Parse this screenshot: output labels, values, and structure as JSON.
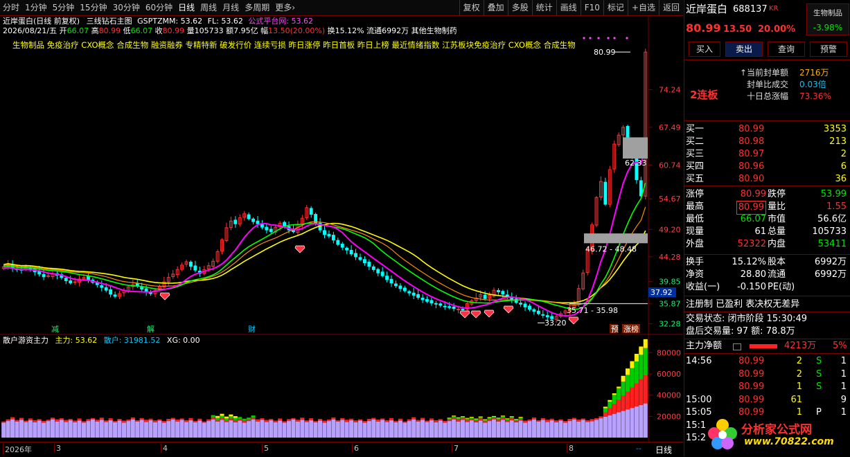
{
  "toolbar": {
    "left": [
      "分时",
      "1分钟",
      "5分钟",
      "15分钟",
      "30分钟",
      "60分钟",
      "日线",
      "周线",
      "月线",
      "多周期",
      "更多›"
    ],
    "right": [
      "复权",
      "叠加",
      "多股",
      "统计",
      "画线",
      "F10",
      "标记",
      "+自选",
      "返回"
    ],
    "active": "日线"
  },
  "header": {
    "stock_title": "近岸蛋白(日线 前复权)",
    "indicator_main": "三线钻石主图",
    "gsp": "GSPTZMM: 53.62",
    "fl": "FL: 53.62",
    "formula_site": "公式平台网: 53.62",
    "date": "2026/08/21/五",
    "open_label": "开",
    "open": "66.07",
    "high_label": "高",
    "high": "80.99",
    "low_label": "低",
    "low": "66.07",
    "close_label": "收",
    "close": "80.99",
    "vol_label": "量",
    "vol": "105733",
    "amt_label": "额",
    "amt": "7.95亿",
    "chg_label": "幅",
    "chg": "13.50(20.00%)",
    "turnover": "换15.12%",
    "float": "流通6992万",
    "industry": "其他生物制药",
    "concepts": "生物制品 免疫治疗 CXO概念 合成生物 融资融券 专精特新 破发行价 连续亏损 昨日涨停 昨日首板 昨日上榜 最近情绪指数 江苏板块免疫治疗 CXO概念 合成生物"
  },
  "price_axis": [
    "74.24",
    "67.49",
    "60.74",
    "54.67",
    "49.20",
    "44.28",
    "39.85",
    "35.87",
    "32.28"
  ],
  "current_price_tag": "37.92",
  "annotations": {
    "high_label": "80.99",
    "gap_upper": "62.33",
    "gap_mid": "46.72 - 48.48",
    "gap_low": "35.71 - 35.98",
    "low_label": "33.20"
  },
  "event_markers": [
    {
      "text": "减",
      "color": "#00ff66"
    },
    {
      "text": "解",
      "color": "#00ff66"
    },
    {
      "text": "财",
      "color": "#00c8ff"
    },
    {
      "text": "预",
      "color": "#ffffff"
    },
    {
      "text": "涨榜",
      "color": "#ffffff"
    }
  ],
  "sub": {
    "title": "散户游资主力",
    "zl_label": "主力: 53.62",
    "sh_label": "散户: 31981.52",
    "xg_label": "XG: 0.00",
    "axis": [
      "80000",
      "60000",
      "40000",
      "20000"
    ]
  },
  "date_axis": [
    "2026年",
    "3",
    "4",
    "5",
    "6",
    "7",
    "8"
  ],
  "bottom_tab": "日线",
  "colors": {
    "up": "#ff3232",
    "down": "#00ffff",
    "ma1": "#ff00ff",
    "ma2": "#00ff00",
    "ma3": "#ffff00",
    "ma4": "#ff8c00"
  },
  "panel": {
    "name": "近岸蛋白",
    "code": "688137",
    "tag": "KR",
    "sector": "生物制品",
    "sector_chg": "-3.98%",
    "price": "80.99",
    "change": "13.50",
    "pct": "20.00%",
    "buttons": [
      "买入",
      "卖出",
      "查询",
      "预警"
    ],
    "seal_label": "当前封单额",
    "seal_value": "2716万",
    "seal_ratio_label": "封单比成交",
    "seal_ratio_value": "0.03倍",
    "ten_day_label": "十日总涨幅",
    "ten_day_value": "73.36%",
    "board": "2连板",
    "bids": [
      {
        "label": "买一",
        "price": "80.99",
        "vol": "3353"
      },
      {
        "label": "买二",
        "price": "80.98",
        "vol": "213"
      },
      {
        "label": "买三",
        "price": "80.97",
        "vol": "2"
      },
      {
        "label": "买四",
        "price": "80.96",
        "vol": "6"
      },
      {
        "label": "买五",
        "price": "80.90",
        "vol": "36"
      }
    ],
    "stats": [
      {
        "l1": "涨停",
        "v1": "80.99",
        "c1": "red",
        "l2": "跌停",
        "v2": "53.99",
        "c2": "grn"
      },
      {
        "l1": "最高",
        "v1": "80.99",
        "c1": "red",
        "l2": "量比",
        "v2": "1.55",
        "c2": "red"
      },
      {
        "l1": "最低",
        "v1": "66.07",
        "c1": "grn",
        "l2": "市值",
        "v2": "56.6亿",
        "c2": "wht"
      },
      {
        "l1": "现量",
        "v1": "61",
        "c1": "wht",
        "l2": "总量",
        "v2": "105733",
        "c2": "wht"
      },
      {
        "l1": "外盘",
        "v1": "52322",
        "c1": "red",
        "l2": "内盘",
        "v2": "53411",
        "c2": "grn"
      }
    ],
    "stats2": [
      {
        "l1": "换手",
        "v1": "15.12%",
        "l2": "股本",
        "v2": "6992万"
      },
      {
        "l1": "净资",
        "v1": "28.80",
        "l2": "流通",
        "v2": "6992万"
      },
      {
        "l1": "收益(一)",
        "v1": "-0.150",
        "l2": "PE(动)",
        "v2": ""
      }
    ],
    "reg": "注册制 已盈利 表决权无差异",
    "trade_state": "交易状态: 闭市阶段 15:30:49",
    "after_hours": "盘后交易量: 97  额: 78.8万",
    "flow_label": "主力净额",
    "flow_value": "4213万",
    "flow_pct": "5%",
    "ticks": [
      {
        "time": "14:56",
        "price": "80.99",
        "vol": "2",
        "bs": "S",
        "n": "1"
      },
      {
        "time": "",
        "price": "80.99",
        "vol": "2",
        "bs": "S",
        "n": "1"
      },
      {
        "time": "",
        "price": "80.99",
        "vol": "1",
        "bs": "S",
        "n": "1"
      },
      {
        "time": "15:00",
        "price": "80.99",
        "vol": "61",
        "bs": "",
        "n": "9"
      },
      {
        "time": "15:05",
        "price": "80.99",
        "vol": "1",
        "bs": "P",
        "n": "1"
      },
      {
        "time": "15:1",
        "price": "",
        "vol": "",
        "bs": "",
        "n": ""
      },
      {
        "time": "15:2",
        "price": "",
        "vol": "",
        "bs": "",
        "n": ""
      }
    ],
    "logo_text": "分析家公式网",
    "logo_url": "www.70822.com"
  },
  "chart_data": {
    "type": "candlestick",
    "ylim": [
      30.5,
      82
    ],
    "closes": [
      42.5,
      42.8,
      42.3,
      42.0,
      41.9,
      42.4,
      42.1,
      41.6,
      41.2,
      40.7,
      40.9,
      41.3,
      41.0,
      40.6,
      40.0,
      39.6,
      39.8,
      40.3,
      40.6,
      40.2,
      39.7,
      39.3,
      38.8,
      38.3,
      37.6,
      37.2,
      37.7,
      38.3,
      38.9,
      39.3,
      39.0,
      38.5,
      38.0,
      37.7,
      38.3,
      39.0,
      39.8,
      40.6,
      41.2,
      42.0,
      42.8,
      43.4,
      42.6,
      41.9,
      41.3,
      42.0,
      42.7,
      43.5,
      45.2,
      47.3,
      49.5,
      50.7,
      50.2,
      51.3,
      52.0,
      51.1,
      50.6,
      50.2,
      49.6,
      49.1,
      48.8,
      49.6,
      50.3,
      49.8,
      49.1,
      48.8,
      50.1,
      51.2,
      53.1,
      51.9,
      50.2,
      49.1,
      48.3,
      48.0,
      47.3,
      46.5,
      46.0,
      45.5,
      44.8,
      44.3,
      43.8,
      43.2,
      42.6,
      42.0,
      41.4,
      40.9,
      40.2,
      39.6,
      39.1,
      38.6,
      38.2,
      37.8,
      37.4,
      37.0,
      36.6,
      36.3,
      36.0,
      35.8,
      35.6,
      35.4,
      35.2,
      35.0,
      34.9,
      34.8,
      35.9,
      36.4,
      36.9,
      37.5,
      36.8,
      37.4,
      38.3,
      38.0,
      37.6,
      37.1,
      36.6,
      36.1,
      35.8,
      35.3,
      34.9,
      34.5,
      34.1,
      33.8,
      33.5,
      33.2,
      33.6,
      34.1,
      34.6,
      35.1,
      35.7,
      38.6,
      41.4,
      45.6,
      50.0,
      54.9,
      57.8,
      53.7,
      59.9,
      64.5,
      66.1,
      67.5,
      64.2,
      62.3,
      58.1,
      55.2,
      80.99
    ],
    "ma_pink": "short moving average",
    "sub_series": {
      "type": "stacked-bar",
      "ylim": [
        0,
        90000
      ]
    }
  }
}
